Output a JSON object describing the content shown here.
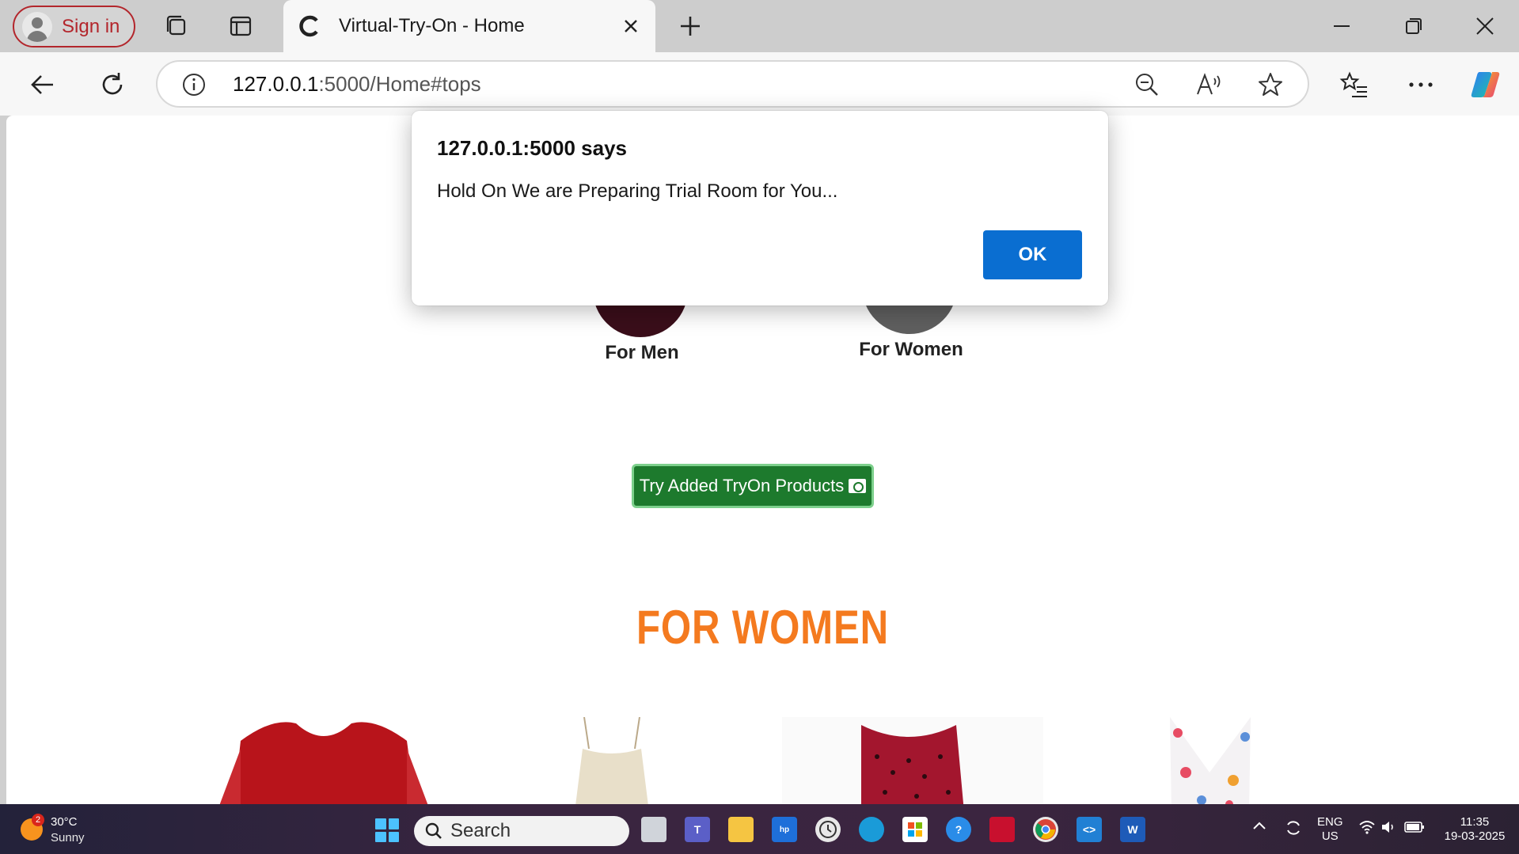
{
  "browser": {
    "signin_label": "Sign in",
    "tab_title": "Virtual-Try-On - Home",
    "url_host": "127.0.0.1",
    "url_rest": ":5000/Home#tops"
  },
  "page": {
    "category_men": "For Men",
    "category_women": "For Women",
    "try_button_label": "Try Added TryOn Products",
    "section_title": "FOR WOMEN"
  },
  "dialog": {
    "title": "127.0.0.1:5000 says",
    "message": "Hold On We are Preparing Trial Room for You...",
    "ok_label": "OK"
  },
  "taskbar": {
    "weather_badge": "2",
    "weather_temp": "30°C",
    "weather_condition": "Sunny",
    "search_placeholder": "Search",
    "lang_line1": "ENG",
    "lang_line2": "US",
    "time": "11:35",
    "date": "19-03-2025"
  },
  "colors": {
    "accent_orange": "#f47a1f",
    "try_button_green": "#1d7a2d",
    "dialog_ok_blue": "#0a6ed1",
    "signin_red": "#b3262c"
  }
}
